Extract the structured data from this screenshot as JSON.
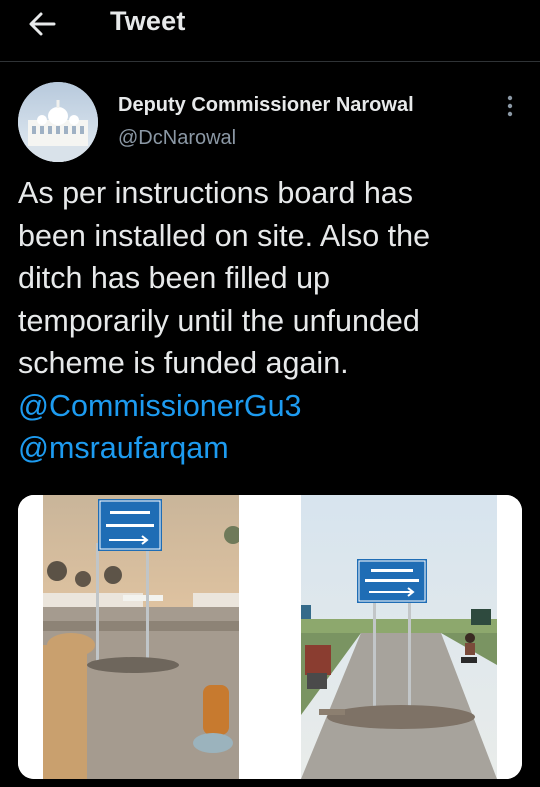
{
  "header": {
    "title": "Tweet",
    "back_icon": "arrow-left-icon"
  },
  "tweet": {
    "author_name": "Deputy Commissioner Narowal",
    "author_handle": "@DcNarowal",
    "more_icon": "more-vertical-icon",
    "text": "As per instructions board has\nbeen installed on site. Also the\nditch has been filled up\ntemporarily until the unfunded\nscheme is funded again.",
    "mentions": [
      "@CommissionerGu3",
      "@msraufarqam"
    ]
  },
  "colors": {
    "background": "#000000",
    "text": "#e7e9ea",
    "secondary": "#8b98a5",
    "link": "#1d9bf0"
  }
}
